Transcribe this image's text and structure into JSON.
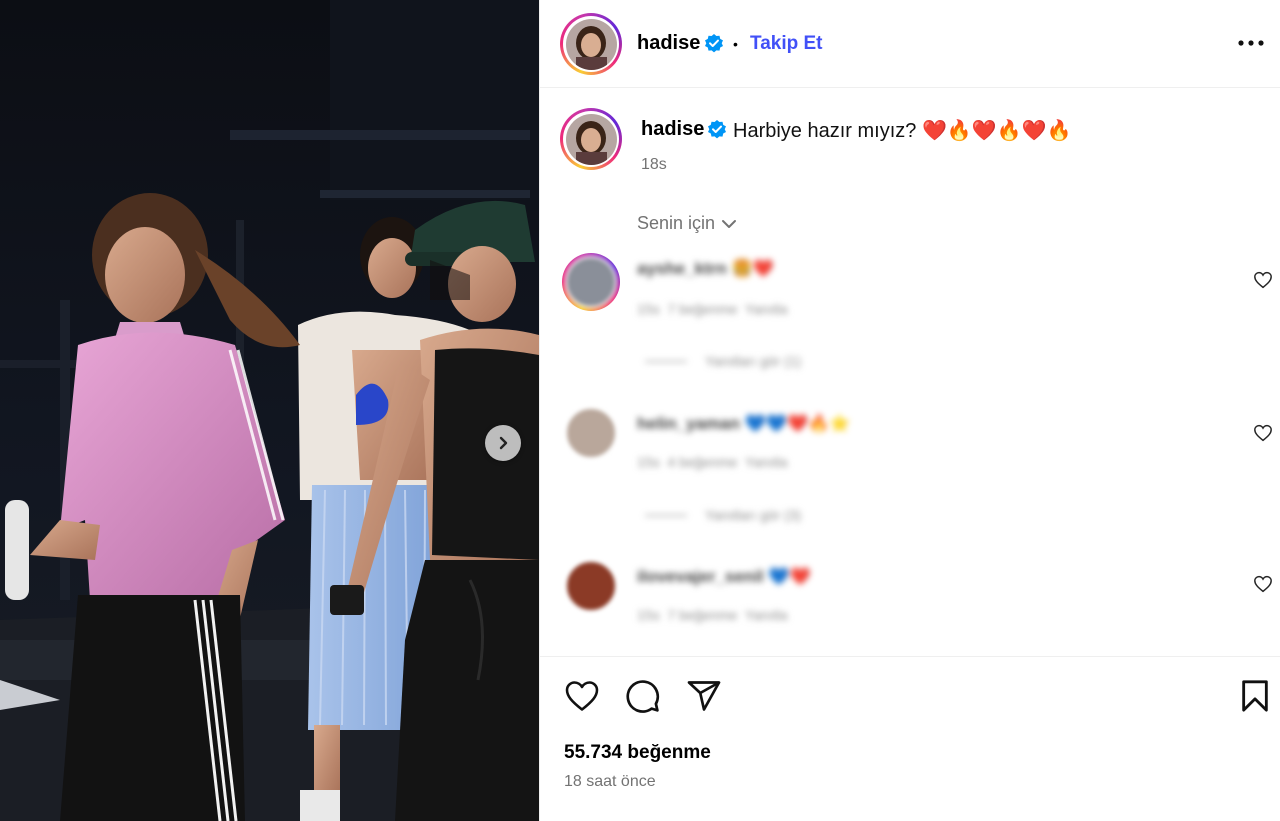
{
  "post": {
    "author": {
      "username": "hadise",
      "verified": true,
      "follow_label": "Takip Et",
      "separator": "•"
    },
    "more_icon": "more-horizontal-icon",
    "caption": {
      "username": "hadise",
      "text": "Harbiye hazır mıyız? ❤️🔥❤️🔥❤️🔥",
      "age": "18s"
    },
    "comments_filter": {
      "label": "Senin için",
      "icon": "chevron-down-icon"
    },
    "comments": [
      {
        "username": "ayshe_ktrn",
        "emoji": "🍔❤️",
        "meta": "15s  7 beğenme  Yanıtla",
        "replies_label": "Yanıtları gör (1)",
        "avatar_color": "#8a8f99"
      },
      {
        "username": "helin_yaman",
        "emoji": "💙💙❤️🔥⭐",
        "meta": "15s  4 beğenme  Yanıtla",
        "replies_label": "Yanıtları gör (3)",
        "avatar_color": "#b9a79b"
      },
      {
        "username": "ilovevajer_senil",
        "emoji": "💙❤️",
        "meta": "15s  7 beğenme  Yanıtla",
        "replies_label": "",
        "avatar_color": "#8b3a26"
      }
    ],
    "likes_label": "55.734 beğenme",
    "time_label": "18 saat önce",
    "colors": {
      "follow": "#4150f7",
      "verified": "#0095f6",
      "muted": "#737373",
      "divider": "#efefef"
    },
    "action_icons": [
      "heart-icon",
      "comment-icon",
      "share-icon",
      "bookmark-icon"
    ]
  }
}
